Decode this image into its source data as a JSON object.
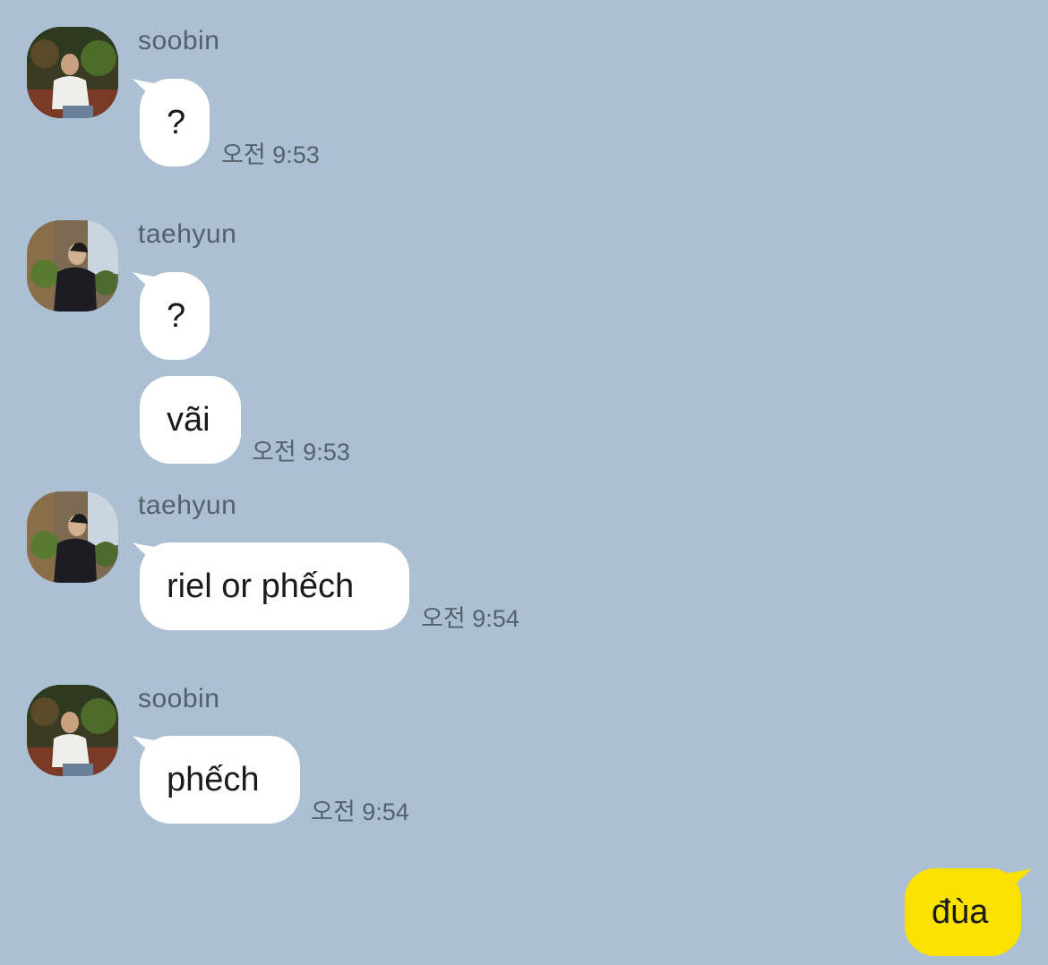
{
  "colors": {
    "background": "#abc1d3",
    "incoming_bubble": "#ffffff",
    "outgoing_bubble": "#fae100"
  },
  "messages": [
    {
      "sender": "soobin",
      "avatar_icon": "profile-photo-icon",
      "bubbles": [
        "?"
      ],
      "time": "오전 9:53"
    },
    {
      "sender": "taehyun",
      "avatar_icon": "profile-photo-icon",
      "bubbles": [
        "?",
        "vãi"
      ],
      "time": "오전 9:53"
    },
    {
      "sender": "taehyun",
      "avatar_icon": "profile-photo-icon",
      "bubbles": [
        "riel or phếch"
      ],
      "time": "오전 9:54"
    },
    {
      "sender": "soobin",
      "avatar_icon": "profile-photo-icon",
      "bubbles": [
        "phếch"
      ],
      "time": "오전 9:54"
    }
  ],
  "outgoing": {
    "text": "đùa"
  }
}
